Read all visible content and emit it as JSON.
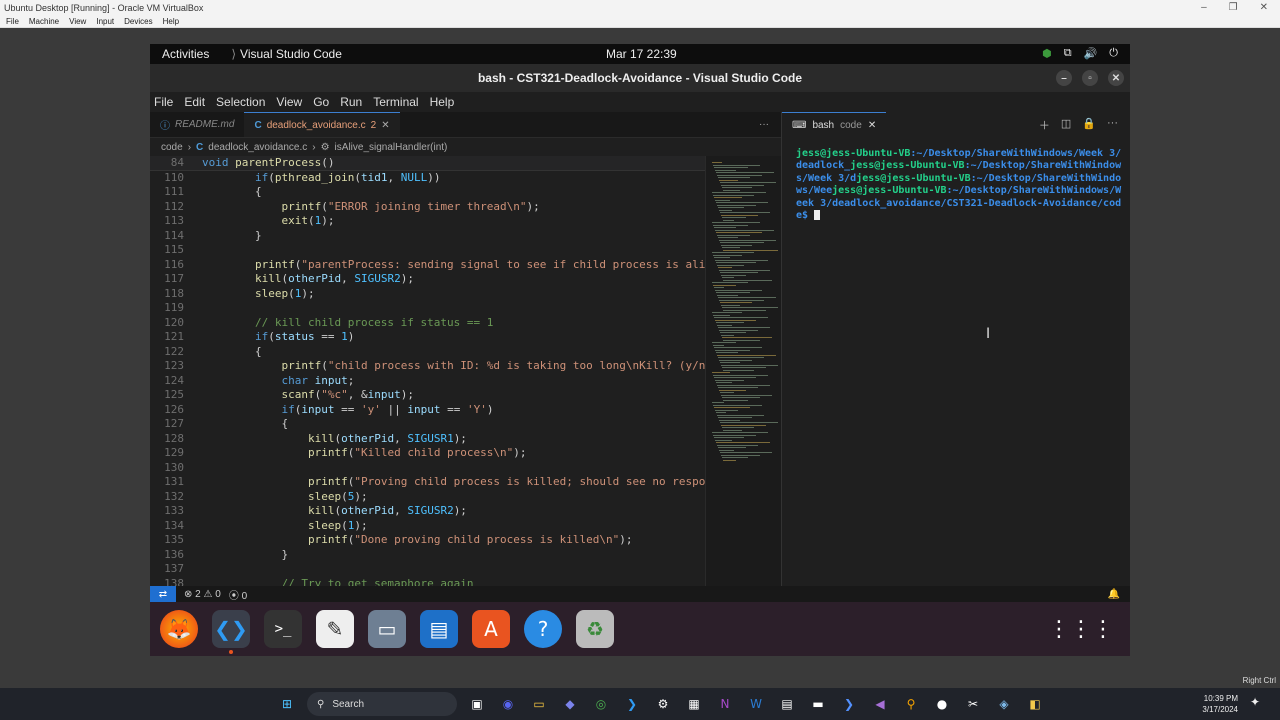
{
  "host": {
    "title": "Ubuntu Desktop [Running] - Oracle VM VirtualBox",
    "menu": [
      "File",
      "Machine",
      "View",
      "Input",
      "Devices",
      "Help"
    ],
    "status_right": "Right Ctrl"
  },
  "gnome": {
    "activities": "Activities",
    "app_name": "Visual Studio Code",
    "clock": "Mar 17  22:39"
  },
  "window": {
    "title": "bash - CST321-Deadlock-Avoidance - Visual Studio Code"
  },
  "menubar": [
    "File",
    "Edit",
    "Selection",
    "View",
    "Go",
    "Run",
    "Terminal",
    "Help"
  ],
  "tabs": [
    {
      "label": "README.md",
      "badge": ""
    },
    {
      "label": "deadlock_avoidance.c",
      "badge": "2",
      "icon": "C"
    }
  ],
  "breadcrumb": {
    "folder": "code",
    "file": "deadlock_avoidance.c",
    "symbol": "isAlive_signalHandler(int)",
    "icon": "C"
  },
  "editor": {
    "sticky": {
      "num": "84",
      "code": "void parentProcess()"
    },
    "lines": [
      {
        "num": "110",
        "code": "        if(pthread_join(tid1, NULL))"
      },
      {
        "num": "111",
        "code": "        {"
      },
      {
        "num": "112",
        "code": "            printf(\"ERROR joining timer thread\\n\");"
      },
      {
        "num": "113",
        "code": "            exit(1);"
      },
      {
        "num": "114",
        "code": "        }"
      },
      {
        "num": "115",
        "code": ""
      },
      {
        "num": "116",
        "code": "        printf(\"parentProcess: sending signal to see if child process is alive"
      },
      {
        "num": "117",
        "code": "        kill(otherPid, SIGUSR2);"
      },
      {
        "num": "118",
        "code": "        sleep(1);"
      },
      {
        "num": "119",
        "code": ""
      },
      {
        "num": "120",
        "code": "        // kill child process if status == 1"
      },
      {
        "num": "121",
        "code": "        if(status == 1)"
      },
      {
        "num": "122",
        "code": "        {"
      },
      {
        "num": "123",
        "code": "            printf(\"child process with ID: %d is taking too long\\nKill? (y/n)\""
      },
      {
        "num": "124",
        "code": "            char input;"
      },
      {
        "num": "125",
        "code": "            scanf(\"%c\", &input);"
      },
      {
        "num": "126",
        "code": "            if(input == 'y' || input == 'Y')"
      },
      {
        "num": "127",
        "code": "            {"
      },
      {
        "num": "128",
        "code": "                kill(otherPid, SIGUSR1);"
      },
      {
        "num": "129",
        "code": "                printf(\"Killed child process\\n\");"
      },
      {
        "num": "130",
        "code": ""
      },
      {
        "num": "131",
        "code": "                printf(\"Proving child process is killed; should see no respons"
      },
      {
        "num": "132",
        "code": "                sleep(5);"
      },
      {
        "num": "133",
        "code": "                kill(otherPid, SIGUSR2);"
      },
      {
        "num": "134",
        "code": "                sleep(1);"
      },
      {
        "num": "135",
        "code": "                printf(\"Done proving child process is killed\\n\");"
      },
      {
        "num": "136",
        "code": "            }"
      },
      {
        "num": "137",
        "code": ""
      },
      {
        "num": "138",
        "code": "            // Try to get semaphore again"
      }
    ]
  },
  "terminal": {
    "tab_label": "bash",
    "tab_sub": "code",
    "lines": [
      {
        "user": "jess@jess-Ubuntu-VB",
        "rest": ":~/Desktop/ShareWithWindows/Week 3/deadlock_"
      },
      {
        "user": "jess@jess-Ubuntu-VB",
        "rest": ":~/Desktop/ShareWithWindows/Week 3/d"
      },
      {
        "user": "jess@jess-Ubuntu-VB",
        "rest": ":~/Desktop/ShareWithWindows/Wee"
      },
      {
        "user": "jess@jess-Ubuntu-VB",
        "rest": ":~/Desktop/ShareWithWindows/Week 3/deadlock_avoidance/CST321-Deadlock-Avoidance/code$ "
      }
    ]
  },
  "status": {
    "errors": "2",
    "warnings": "0",
    "ports": "0"
  },
  "taskbar": {
    "search": "Search",
    "time": "10:39 PM",
    "date": "3/17/2024"
  }
}
